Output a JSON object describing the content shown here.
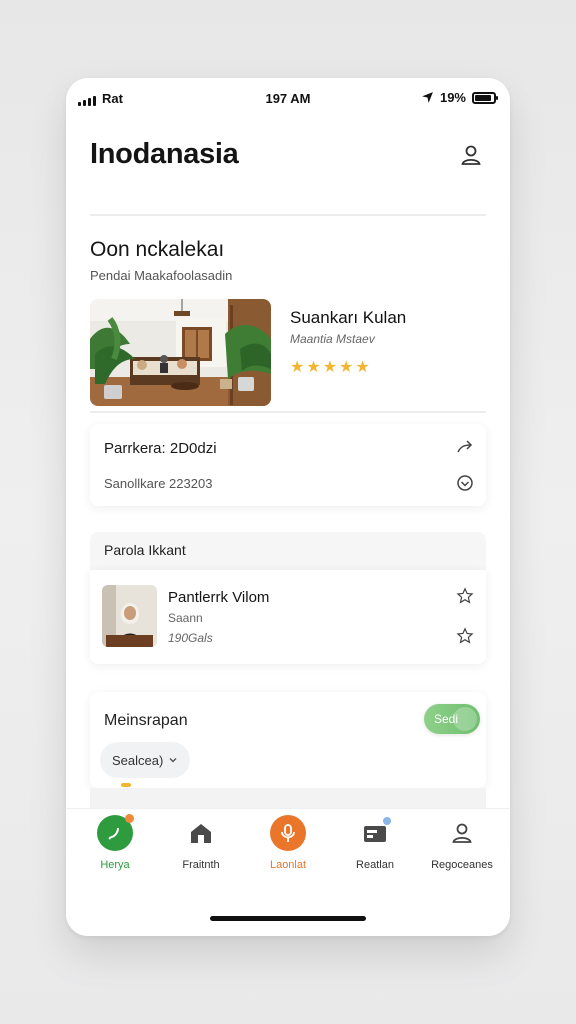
{
  "status_bar": {
    "carrier": "Rat",
    "time": "197 AM",
    "battery": "19%"
  },
  "header": {
    "title": "Inodanasia"
  },
  "section": {
    "title": "Oon nckalekaı",
    "subtitle": "Pendai Maakafoolasadin"
  },
  "feature": {
    "name": "Suankarı Kulan",
    "meta": "Maantia Mstaev",
    "rating": 5
  },
  "info_card": {
    "line1": "Parrkera: 2D0dzi",
    "line2": "Sanollkare 223203"
  },
  "person_group": {
    "header": "Parola Ikkant",
    "name": "Pantlerrk Vilom",
    "meta1": "Saann",
    "meta2": "190Gals"
  },
  "settings_card": {
    "title": "Meinsrapan",
    "toggle_label": "Sedi",
    "select_value": "Sealcea)"
  },
  "nav": {
    "items": [
      {
        "label": "Herya",
        "icon": "leaf-icon"
      },
      {
        "label": "Fraitnth",
        "icon": "home-icon"
      },
      {
        "label": "Laonlat",
        "icon": "mic-icon"
      },
      {
        "label": "Reatlan",
        "icon": "folder-icon"
      },
      {
        "label": "Regoceanes",
        "icon": "user-icon"
      }
    ]
  },
  "colors": {
    "accent_orange": "#e9762b",
    "accent_green": "#2d9b3e",
    "star_gold": "#f2b630",
    "toggle_green": "#7cc77a"
  }
}
